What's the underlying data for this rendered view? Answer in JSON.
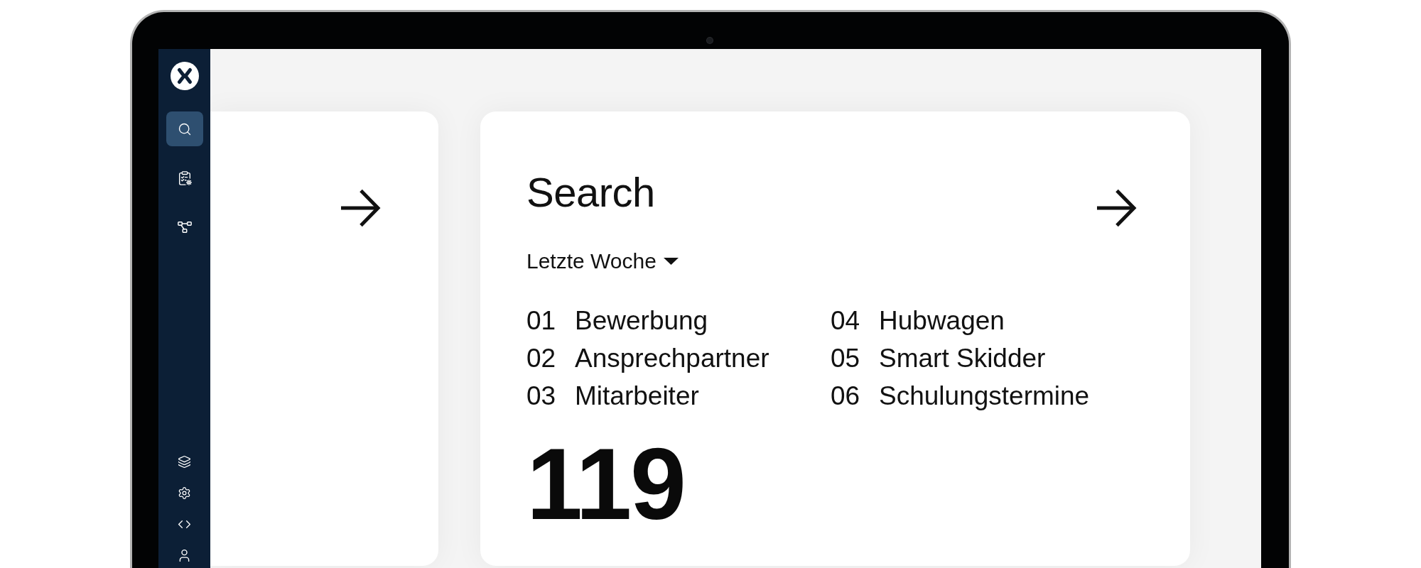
{
  "sidebar": {
    "top_items": [
      {
        "kind": "search",
        "selected": true
      },
      {
        "kind": "checklist",
        "selected": false
      },
      {
        "kind": "network",
        "selected": false
      }
    ],
    "bottom_items": [
      {
        "kind": "layers",
        "selected": false
      },
      {
        "kind": "settings",
        "selected": false
      },
      {
        "kind": "code",
        "selected": false
      },
      {
        "kind": "user",
        "selected": false
      }
    ]
  },
  "search_card": {
    "title": "Search",
    "period_dropdown": {
      "value": "Letzte Woche"
    },
    "top_searches": [
      {
        "rank": "01",
        "term": "Bewerbung"
      },
      {
        "rank": "02",
        "term": "Ansprechpartner"
      },
      {
        "rank": "03",
        "term": "Mitarbeiter"
      },
      {
        "rank": "04",
        "term": "Hubwagen"
      },
      {
        "rank": "05",
        "term": "Smart Skidder"
      },
      {
        "rank": "06",
        "term": "Schulungstermine"
      }
    ],
    "total": "119"
  }
}
